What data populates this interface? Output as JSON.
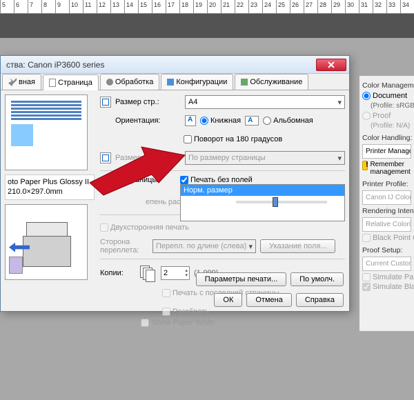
{
  "ruler_numbers": [
    "5",
    "6",
    "7",
    "8",
    "9",
    "10",
    "11",
    "12",
    "13",
    "14",
    "15",
    "16",
    "17",
    "18",
    "19",
    "20",
    "21",
    "22",
    "23",
    "24",
    "25",
    "26",
    "27",
    "28",
    "29",
    "30",
    "31",
    "32",
    "33",
    "34"
  ],
  "dialog": {
    "title": "ства: Canon iP3600 series",
    "tabs": {
      "main": "вная",
      "page": "Страница",
      "process": "Обработка",
      "config": "Конфигурации",
      "service": "Обслуживание"
    },
    "paper_info": {
      "line1": "oto Paper Plus Glossy II",
      "line2": "210.0×297.0mm"
    },
    "fields": {
      "page_size_label": "Размер стр.:",
      "page_size_value": "A4",
      "orientation_label": "Ориентация:",
      "orient_portrait": "Книжная",
      "orient_landscape": "Альбомная",
      "rotate_180": "Поворот на 180 градусов",
      "paper_size_label": "Размер бумаги:",
      "paper_size_value": "По размеру страницы",
      "layout_label": "Макет страницы:",
      "borderless": "Печать без полей",
      "list_selected": "Норм. размер",
      "extension_label": "епень расширения:",
      "duplex": "Двухсторонняя печать",
      "binding_label": "Сторона переплета:",
      "binding_value": "Перепл. по длине (слева)",
      "margin_btn": "Указание поля...",
      "copies_label": "Копии:",
      "copies_value": "2",
      "copies_range": "(1-999)",
      "from_last": "Печать с последней страницы",
      "collate": "Разобрать"
    },
    "buttons": {
      "print_params": "Параметры печати...",
      "defaults": "По умолч.",
      "ok": "ОК",
      "cancel": "Отмена",
      "help": "Справка"
    }
  },
  "right": {
    "title": "Color Management",
    "document": "Document",
    "profile": "(Profile: sRGB IE",
    "proof": "Proof",
    "profile_na": "(Profile: N/A)",
    "handling": "Color Handling:",
    "handling_value": "Printer Manages Col",
    "remember": "Remember management",
    "printer_profile": "Printer Profile:",
    "printer_profile_value": "Canon IJ Color Prin",
    "rendering": "Rendering Intent:",
    "rendering_value": "Relative Colorimetric",
    "black_point": "Black Point Com",
    "proof_setup": "Proof Setup:",
    "proof_value": "Current Custom Set",
    "sim_paper": "Simulate Paper",
    "sim_black": "Simulate Black I"
  },
  "show_paper_white": "Show Paper White"
}
